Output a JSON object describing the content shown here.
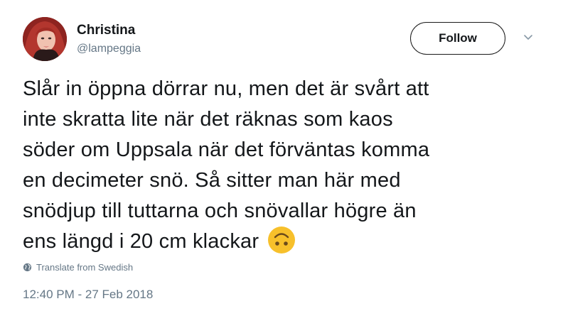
{
  "user": {
    "display_name": "Christina",
    "handle": "@lampeggia"
  },
  "actions": {
    "follow_label": "Follow"
  },
  "tweet": {
    "lines": [
      "Slår in öppna dörrar nu, men det är svårt att",
      "inte skratta lite när det räknas som kaos",
      "söder om Uppsala när det förväntas komma",
      "en decimeter snö. Så sitter man här med",
      "snödjup till tuttarna och snövallar högre än",
      "ens längd i 20 cm klackar"
    ],
    "emoji": "upside-down-face"
  },
  "translate": {
    "label": "Translate from Swedish",
    "icon": "globe-icon"
  },
  "meta": {
    "timestamp": "12:40 PM - 27 Feb 2018"
  },
  "colors": {
    "text": "#14171a",
    "secondary": "#657786",
    "emoji": "#f7c02b"
  }
}
